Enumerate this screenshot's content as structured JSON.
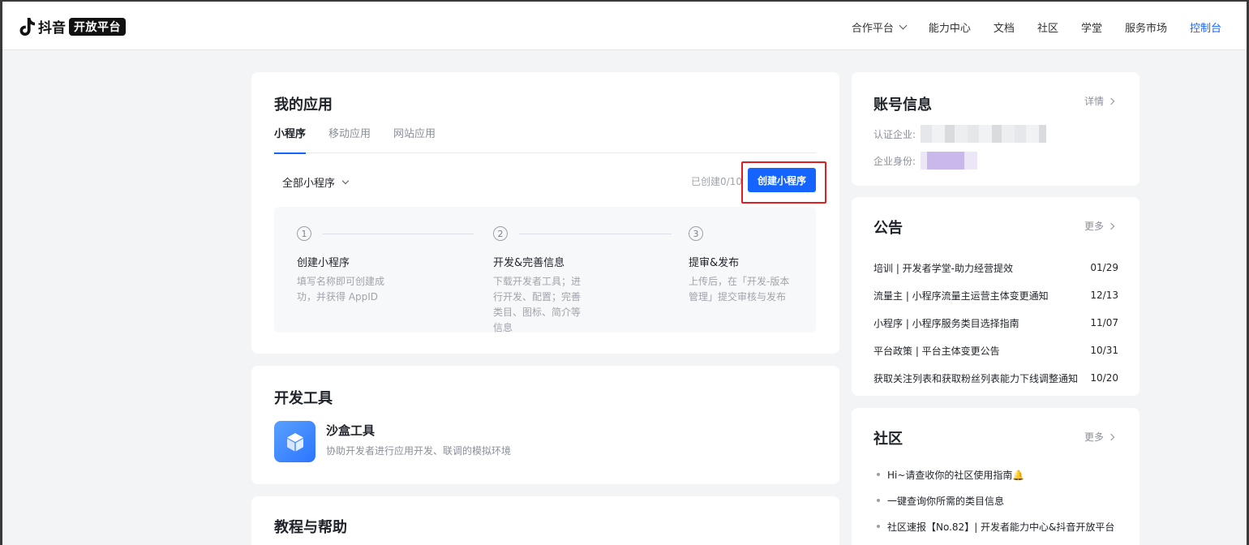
{
  "header": {
    "logo_text": "抖音",
    "logo_badge": "开放平台",
    "nav": [
      {
        "label": "合作平台"
      },
      {
        "label": "能力中心"
      },
      {
        "label": "文档"
      },
      {
        "label": "社区"
      },
      {
        "label": "学堂"
      },
      {
        "label": "服务市场"
      },
      {
        "label": "控制台"
      }
    ],
    "active_color": "#1664ff"
  },
  "apps": {
    "title": "我的应用",
    "tabs": [
      {
        "label": "小程序"
      },
      {
        "label": "移动应用"
      },
      {
        "label": "网站应用"
      }
    ],
    "filter_label": "全部小程序",
    "created_count": "已创建0/10",
    "create_button": "创建小程序",
    "steps": [
      {
        "num": "1",
        "title": "创建小程序",
        "desc": "填写名称即可创建成功，并获得 AppID"
      },
      {
        "num": "2",
        "title": "开发&完善信息",
        "desc": "下载开发者工具；进行开发、配置；完善类目、图标、简介等信息"
      },
      {
        "num": "3",
        "title": "提审&发布",
        "desc": "上传后，在「开发-版本管理」提交审核与发布"
      }
    ]
  },
  "tools": {
    "title": "开发工具",
    "items": [
      {
        "name": "沙盒工具",
        "desc": "协助开发者进行应用开发、联调的模拟环境",
        "icon": "cube-icon"
      }
    ]
  },
  "help": {
    "title": "教程与帮助"
  },
  "account": {
    "title": "账号信息",
    "more_label": "详情",
    "company_label": "认证企业:",
    "identity_label": "企业身份:"
  },
  "notice": {
    "title": "公告",
    "more_label": "更多",
    "items": [
      {
        "text": "培训 | 开发者学堂-助力经营提效",
        "date": "01/29"
      },
      {
        "text": "流量主 | 小程序流量主运营主体变更通知",
        "date": "12/13"
      },
      {
        "text": "小程序 | 小程序服务类目选择指南",
        "date": "11/07"
      },
      {
        "text": "平台政策 | 平台主体变更公告",
        "date": "10/31"
      },
      {
        "text": "获取关注列表和获取粉丝列表能力下线调整通知",
        "date": "10/20"
      }
    ]
  },
  "community": {
    "title": "社区",
    "more_label": "更多",
    "items": [
      {
        "text": "Hi~请查收你的社区使用指南🔔"
      },
      {
        "text": "一键查询你所需的类目信息"
      },
      {
        "text": "社区速报【No.82】| 开发者能力中心&抖音开放平台"
      }
    ]
  }
}
